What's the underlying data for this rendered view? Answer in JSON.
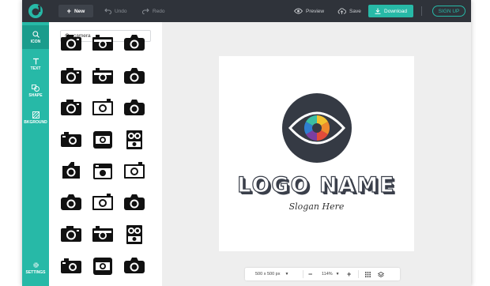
{
  "toolbar": {
    "new_label": "New",
    "undo_label": "Undo",
    "redo_label": "Redo",
    "preview_label": "Preview",
    "save_label": "Save",
    "download_label": "Download",
    "signup_label": "SIGN UP"
  },
  "sidebar": {
    "items": [
      {
        "label": "ICON",
        "icon": "search-icon",
        "active": true
      },
      {
        "label": "TEXT",
        "icon": "text-icon",
        "active": false
      },
      {
        "label": "SHAPE",
        "icon": "shapes-icon",
        "active": false
      },
      {
        "label": "BKGROUND",
        "icon": "background-icon",
        "active": false
      },
      {
        "label": "SETTINGS",
        "icon": "gear-icon",
        "active": false
      }
    ]
  },
  "icon_panel": {
    "search_value": "camera",
    "results_icon": "camera-icon"
  },
  "canvas": {
    "logo_name": "LOGO NAME",
    "slogan": "Slogan Here",
    "emblem_icon": "eye-icon"
  },
  "bottom_bar": {
    "canvas_size": "500 x 500 px",
    "zoom": "114%"
  },
  "colors": {
    "accent": "#27b9a7",
    "topbar": "#2f333a",
    "emblem": "#353a44"
  }
}
